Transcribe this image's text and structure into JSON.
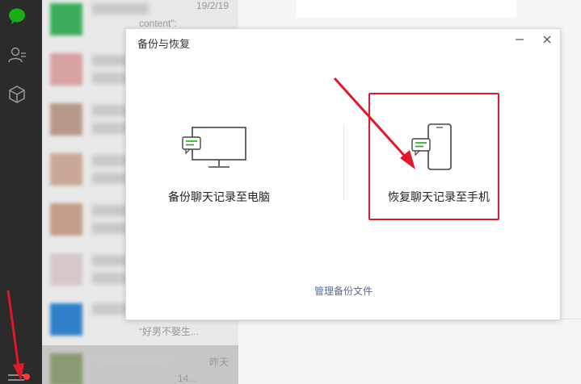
{
  "chat_list": {
    "rows": [
      {
        "time": "19/2/19",
        "preview": "content\":"
      },
      {
        "time": "",
        "preview": ""
      },
      {
        "time": "",
        "preview": ""
      },
      {
        "time": "",
        "preview": ""
      },
      {
        "time": "",
        "preview": ""
      },
      {
        "time": "",
        "preview": ""
      },
      {
        "time": "",
        "preview": "“好男不娶生..."
      },
      {
        "time": "昨天",
        "preview": "14..."
      }
    ]
  },
  "dialog": {
    "title": "备份与恢复",
    "backup_label": "备份聊天记录至电脑",
    "restore_label": "恢复聊天记录至手机",
    "manage_link": "管理备份文件"
  },
  "colors": {
    "accent_green": "#1aad19",
    "annotation_red": "#e1182a",
    "link_blue": "#576b95"
  }
}
